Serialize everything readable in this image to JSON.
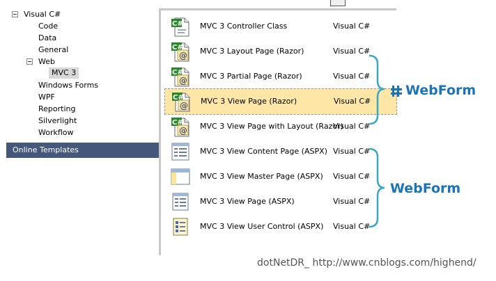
{
  "tree": {
    "items": [
      {
        "label": "Visual C#"
      },
      {
        "label": "Code"
      },
      {
        "label": "Data"
      },
      {
        "label": "General"
      },
      {
        "label": "Web"
      },
      {
        "label": "MVC 3"
      },
      {
        "label": "Windows Forms"
      },
      {
        "label": "WPF"
      },
      {
        "label": "Reporting"
      },
      {
        "label": "Silverlight"
      },
      {
        "label": "Workflow"
      }
    ],
    "online_templates": "Online Templates"
  },
  "templates": [
    {
      "name": "MVC 3 Controller Class",
      "lang": "Visual C#",
      "icon": "csharp-class-icon"
    },
    {
      "name": "MVC 3 Layout Page (Razor)",
      "lang": "Visual C#",
      "icon": "razor-page-icon"
    },
    {
      "name": "MVC 3 Partial Page (Razor)",
      "lang": "Visual C#",
      "icon": "razor-page-icon"
    },
    {
      "name": "MVC 3 View Page (Razor)",
      "lang": "Visual C#",
      "icon": "razor-page-icon"
    },
    {
      "name": "MVC 3 View Page with Layout (Razor)",
      "lang": "Visual C#",
      "icon": "razor-page-icon"
    },
    {
      "name": "MVC 3 View Content Page (ASPX)",
      "lang": "Visual C#",
      "icon": "aspx-content-page-icon"
    },
    {
      "name": "MVC 3 View Master Page (ASPX)",
      "lang": "Visual C#",
      "icon": "aspx-master-page-icon"
    },
    {
      "name": "MVC 3 View Page (ASPX)",
      "lang": "Visual C#",
      "icon": "aspx-page-icon"
    },
    {
      "name": "MVC 3 View User Control (ASPX)",
      "lang": "Visual C#",
      "icon": "aspx-user-control-icon"
    }
  ],
  "annotations": {
    "razor_label": "WebForm",
    "aspx_label": "WebForm",
    "accent_color": "#1b73b8"
  },
  "watermark": "dotNetDR_  http://www.cnblogs.com/highend/"
}
